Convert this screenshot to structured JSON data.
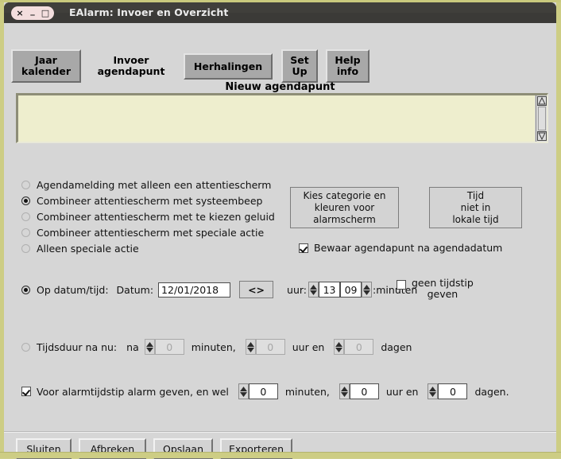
{
  "window": {
    "title": "EAlarm: Invoer en Overzicht",
    "controls": {
      "close": "×",
      "minimize": "_",
      "maximize": "□"
    },
    "colors": {
      "frame": "#cdcd84",
      "titlebar": "#3b3a37",
      "client_bg": "#d6d6d6",
      "textarea_bg": "#eeeece",
      "button_face": "#d3d3d3"
    }
  },
  "tabs": [
    {
      "label": "Jaar\nkalender",
      "name": "tab-jaar-kalender",
      "active": false
    },
    {
      "label": "Invoer\nagendapunt",
      "name": "tab-invoer-agendapunt",
      "active": true
    },
    {
      "label": "Herhalingen",
      "name": "tab-herhalingen",
      "active": false
    },
    {
      "label": "Set\nUp",
      "name": "tab-set-up",
      "active": false
    },
    {
      "label": "Help\ninfo",
      "name": "tab-help-info",
      "active": false
    }
  ],
  "main": {
    "section_title": "Nieuw agendapunt",
    "textarea": {
      "value": "",
      "placeholder": ""
    },
    "alarm_type_options": [
      {
        "label": "Agendamelding met alleen een attentiescherm",
        "selected": false
      },
      {
        "label": "Combineer attentiescherm met systeembeep",
        "selected": true
      },
      {
        "label": "Combineer attentiescherm met te kiezen geluid",
        "selected": false
      },
      {
        "label": "Combineer attentiescherm met speciale actie",
        "selected": false
      },
      {
        "label": "Alleen speciale actie",
        "selected": false
      }
    ],
    "buttons": {
      "category_colors": "Kies categorie en\nkleuren voor\nalarmscherm",
      "local_time": "Tijd\nniet in\nlokale tijd"
    },
    "keep_after_date": {
      "label": "Bewaar agendapunt na agendadatum",
      "checked": true
    },
    "on_datetime": {
      "radio_label": "Op datum/tijd:",
      "selected": true,
      "date_label": "Datum:",
      "date_value": "12/01/2018",
      "swap_button": "<>",
      "hour_label": "uur:",
      "hour_value": "13",
      "minute_value": "09",
      "minute_label": ":minuten",
      "no_time_checkbox": {
        "label": "geen tijdstip\ngeven",
        "checked": false
      }
    },
    "duration_from_now": {
      "radio_label": "Tijdsduur na nu:",
      "selected": false,
      "enabled": false,
      "prefix": "na",
      "minutes_value": "0",
      "minutes_label": "minuten,",
      "hours_value": "0",
      "hours_label": "uur en",
      "days_value": "0",
      "days_label": "dagen"
    },
    "pre_alarm": {
      "label": "Voor alarmtijdstip alarm geven, en wel",
      "checked": true,
      "minutes_value": "0",
      "minutes_label": "minuten,",
      "hours_value": "0",
      "hours_label": "uur en",
      "days_value": "0",
      "days_label": "dagen."
    }
  },
  "footer": {
    "buttons": [
      {
        "label": "Sluiten",
        "name": "sluiten-button"
      },
      {
        "label": "Afbreken",
        "name": "afbreken-button"
      },
      {
        "label": "Opslaan",
        "name": "opslaan-button"
      },
      {
        "label": "Exporteren",
        "name": "exporteren-button"
      }
    ]
  },
  "scrollbar": {
    "up": "▲",
    "down": "▼"
  }
}
